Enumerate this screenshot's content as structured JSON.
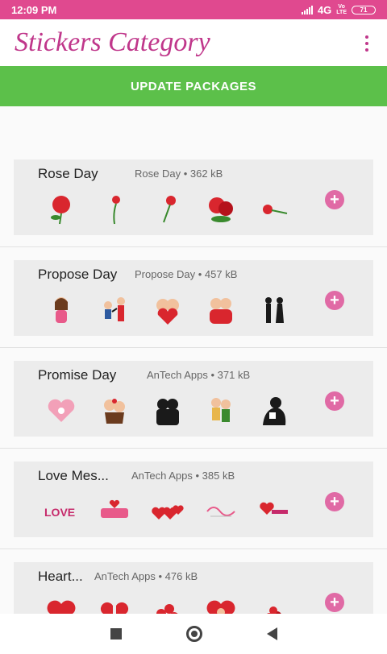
{
  "status": {
    "time": "12:09 PM",
    "network": "4G",
    "volte_top": "Vo",
    "volte_bottom": "LTE",
    "battery": "71"
  },
  "app_bar": {
    "title": "Stickers Category",
    "menu_icon": "more-vert-icon"
  },
  "update_button": {
    "label": "UPDATE PACKAGES"
  },
  "colors": {
    "status_bar": "#e0498f",
    "title": "#c0378b",
    "update_button": "#5cc04a",
    "add_button": "#e06aa5"
  },
  "packs": [
    {
      "name": "Rose Day",
      "meta": "Rose Day • 362 kB",
      "stickers": [
        "rose-bloom",
        "rose-stem",
        "rose-bud",
        "rose-pair",
        "rose-lying"
      ]
    },
    {
      "name": "Propose Day",
      "meta": "Propose Day • 457 kB",
      "stickers": [
        "girl-cartoon",
        "kneeling-proposal",
        "couple-heart",
        "couple-hug",
        "silhouette-proposal"
      ]
    },
    {
      "name": "Promise Day",
      "meta": "AnTech Apps • 371 kB",
      "stickers": [
        "pink-heart",
        "couple-cartoon",
        "silhouette-kiss",
        "couple-dance",
        "silhouette-embrace"
      ]
    },
    {
      "name": "Love Mes...",
      "meta": "AnTech Apps • 385 kB",
      "stickers": [
        "love-text",
        "love-banner",
        "hearts-red",
        "love-script",
        "hearts-text"
      ]
    },
    {
      "name": "Heart...",
      "meta": "AnTech Apps • 476 kB",
      "stickers": [
        "heart-glow",
        "heart-split",
        "hearts-cluster",
        "heart-pair",
        "heart-pile"
      ]
    }
  ],
  "add_icon": "plus-icon",
  "nav": {
    "recents_icon": "square-icon",
    "home_icon": "circle-icon",
    "back_icon": "triangle-back-icon"
  }
}
